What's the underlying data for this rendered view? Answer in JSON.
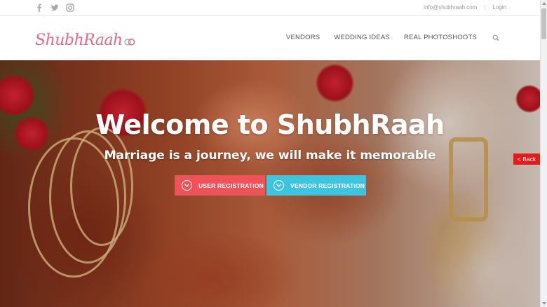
{
  "topbar": {
    "social": [
      "facebook-icon",
      "twitter-icon",
      "instagram-icon"
    ],
    "email": "info@shubhraah.com",
    "separator": "|",
    "login": "Login"
  },
  "header": {
    "logo": "ShubhRaah",
    "nav": [
      "VENDORS",
      "WEDDING IDEAS",
      "REAL PHOTOSHOOTS"
    ],
    "search_icon": "search-icon"
  },
  "hero": {
    "title": "Welcome to ShubhRaah",
    "subtitle": "Marriage is a journey, we will make it memorable",
    "user_button": "USER REGISTRATION",
    "vendor_button": "VENDOR REGISTRATION",
    "button_icon": "chevron-down-circle-icon"
  },
  "back": "< Back",
  "colors": {
    "logo_pink": "#e46a8a",
    "user_button": "#f0525a",
    "vendor_button": "#3fc4e0",
    "back_button": "#e31b1b"
  }
}
